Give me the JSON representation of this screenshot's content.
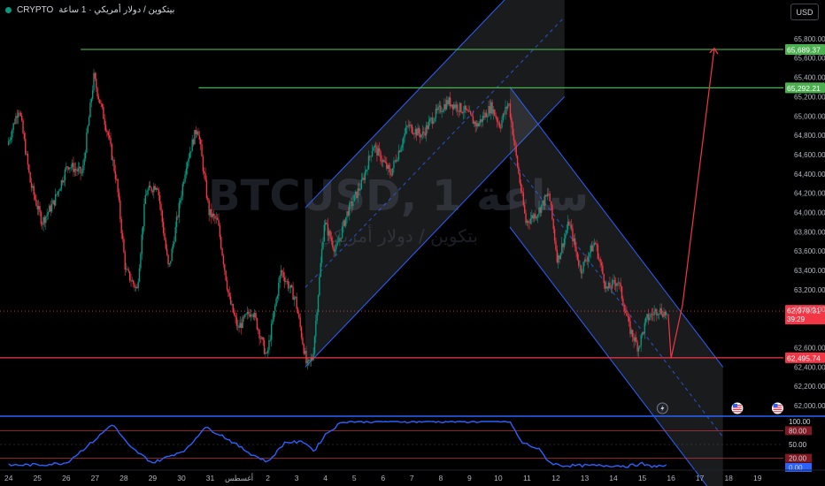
{
  "header": {
    "symbol": "CRYPTO",
    "exchange_text": "بيتكوين / دولار أمريكي · 1 ساعة",
    "currency_button": "USD"
  },
  "watermark": {
    "main": "BTCUSD, 1 ساعة",
    "sub": "بتكوين / دولار أمريكي"
  },
  "colors": {
    "background": "#000000",
    "up": "#089981",
    "down": "#f23645",
    "channel": "#2962ff",
    "green_line": "#4caf50",
    "red_line": "#f23645",
    "rsi": "#2962ff"
  },
  "chart_data": {
    "type": "candlestick",
    "price_axis": {
      "min": 61900,
      "max": 66000,
      "ticks": [
        "65,800.00",
        "65,600.00",
        "65,400.00",
        "65,200.00",
        "65,000.00",
        "64,800.00",
        "64,600.00",
        "64,400.00",
        "64,200.00",
        "64,000.00",
        "63,800.00",
        "63,600.00",
        "63,400.00",
        "63,200.00",
        "63,000.00",
        "62,600.00",
        "62,400.00",
        "62,200.00",
        "62,000.00"
      ],
      "tick_values": [
        65800,
        65600,
        65400,
        65200,
        65000,
        64800,
        64600,
        64400,
        64200,
        64000,
        63800,
        63600,
        63400,
        63200,
        63000,
        62600,
        62400,
        62200,
        62000
      ]
    },
    "time_axis": {
      "labels": [
        "24",
        "25",
        "26",
        "27",
        "28",
        "29",
        "30",
        "31",
        "أغسطس",
        "2",
        "3",
        "4",
        "5",
        "6",
        "7",
        "8",
        "9",
        "10",
        "11",
        "12",
        "13",
        "14",
        "15",
        "16",
        "17",
        "18",
        "19"
      ],
      "day_offsets": [
        0,
        1,
        2,
        3,
        4,
        5,
        6,
        7,
        8,
        9,
        10,
        11,
        12,
        13,
        14,
        15,
        16,
        17,
        18,
        19,
        20,
        21,
        22,
        23,
        24,
        25,
        26
      ],
      "range": [
        -0.3,
        26.9
      ]
    },
    "anchors": [
      {
        "d": 0,
        "p": 64700
      },
      {
        "d": 0.4,
        "p": 65100
      },
      {
        "d": 0.8,
        "p": 64300
      },
      {
        "d": 1.2,
        "p": 63900
      },
      {
        "d": 1.6,
        "p": 64100
      },
      {
        "d": 2.1,
        "p": 64500
      },
      {
        "d": 2.6,
        "p": 64400
      },
      {
        "d": 3.0,
        "p": 65400
      },
      {
        "d": 3.5,
        "p": 64800
      },
      {
        "d": 3.8,
        "p": 64300
      },
      {
        "d": 4.1,
        "p": 63400
      },
      {
        "d": 4.5,
        "p": 63200
      },
      {
        "d": 4.8,
        "p": 64200
      },
      {
        "d": 5.2,
        "p": 64300
      },
      {
        "d": 5.6,
        "p": 63400
      },
      {
        "d": 6.2,
        "p": 64500
      },
      {
        "d": 6.6,
        "p": 64900
      },
      {
        "d": 7.0,
        "p": 64000
      },
      {
        "d": 7.3,
        "p": 63900
      },
      {
        "d": 7.7,
        "p": 63100
      },
      {
        "d": 8.0,
        "p": 62800
      },
      {
        "d": 8.5,
        "p": 63000
      },
      {
        "d": 9.0,
        "p": 62500
      },
      {
        "d": 9.5,
        "p": 63400
      },
      {
        "d": 10.0,
        "p": 63100
      },
      {
        "d": 10.4,
        "p": 62400
      },
      {
        "d": 10.6,
        "p": 62500
      },
      {
        "d": 11.0,
        "p": 63900
      },
      {
        "d": 11.4,
        "p": 63600
      },
      {
        "d": 11.8,
        "p": 64000
      },
      {
        "d": 12.3,
        "p": 64300
      },
      {
        "d": 12.7,
        "p": 64700
      },
      {
        "d": 13.3,
        "p": 64400
      },
      {
        "d": 13.9,
        "p": 64900
      },
      {
        "d": 14.4,
        "p": 64800
      },
      {
        "d": 14.8,
        "p": 65000
      },
      {
        "d": 15.3,
        "p": 65150
      },
      {
        "d": 15.9,
        "p": 65050
      },
      {
        "d": 16.3,
        "p": 64900
      },
      {
        "d": 16.8,
        "p": 65100
      },
      {
        "d": 17.1,
        "p": 64900
      },
      {
        "d": 17.4,
        "p": 65150
      },
      {
        "d": 17.7,
        "p": 64500
      },
      {
        "d": 18.0,
        "p": 63900
      },
      {
        "d": 18.4,
        "p": 64000
      },
      {
        "d": 18.8,
        "p": 64200
      },
      {
        "d": 19.1,
        "p": 63500
      },
      {
        "d": 19.5,
        "p": 63900
      },
      {
        "d": 19.9,
        "p": 63400
      },
      {
        "d": 20.4,
        "p": 63700
      },
      {
        "d": 20.8,
        "p": 63200
      },
      {
        "d": 21.2,
        "p": 63300
      },
      {
        "d": 21.6,
        "p": 62800
      },
      {
        "d": 21.9,
        "p": 62600
      },
      {
        "d": 22.2,
        "p": 62900
      },
      {
        "d": 22.6,
        "p": 63000
      },
      {
        "d": 22.85,
        "p": 62950
      }
    ],
    "levels": [
      {
        "name": "upper-level",
        "value": 65689.37,
        "label": "65,689.37",
        "color": "#4caf50",
        "from_day": 2.5
      },
      {
        "name": "middle-level",
        "value": 65292.21,
        "label": "65,292.21",
        "color": "#4caf50",
        "from_day": 6.6
      },
      {
        "name": "support-level",
        "value": 62495.74,
        "label": "62,495.74",
        "color": "#f23645",
        "from_day": -0.3
      }
    ],
    "current_price": {
      "value": 62979.31,
      "label": "62,979.31",
      "countdown": "39:29"
    },
    "ascending_channel": {
      "d1": 10.3,
      "d2": 19.3,
      "lower1": 62400,
      "lower2": 65200,
      "upper1": 64050,
      "upper2": 66850
    },
    "descending_channel": {
      "d1": 17.4,
      "d2": 24.8,
      "upper1": 65300,
      "upper2": 62400,
      "lower1": 63850,
      "lower2": 60950
    },
    "projection": [
      {
        "d": 22.9,
        "p": 62950
      },
      {
        "d": 23.0,
        "p": 62490
      },
      {
        "d": 23.4,
        "p": 63050
      },
      {
        "d": 24.5,
        "p": 65700
      }
    ],
    "event_markers": [
      {
        "name": "lightning-event-icon",
        "day": 22.7
      },
      {
        "name": "us-flag-event-icon",
        "day": 25.3
      },
      {
        "name": "us-flag-event-icon",
        "day": 26.7
      }
    ],
    "rsi": {
      "ticks": [
        "100.00",
        "80.00",
        "50.00",
        "20.00",
        "0.00"
      ],
      "tick_values": [
        100,
        80,
        50,
        20,
        0
      ],
      "current": "0.00",
      "anchors": [
        {
          "d": 0,
          "v": 5
        },
        {
          "d": 1.2,
          "v": 6
        },
        {
          "d": 2,
          "v": 10
        },
        {
          "d": 3,
          "v": 60
        },
        {
          "d": 3.6,
          "v": 95
        },
        {
          "d": 4.2,
          "v": 45
        },
        {
          "d": 5,
          "v": 10
        },
        {
          "d": 6.2,
          "v": 40
        },
        {
          "d": 6.8,
          "v": 88
        },
        {
          "d": 7.4,
          "v": 70
        },
        {
          "d": 8.4,
          "v": 30
        },
        {
          "d": 9.0,
          "v": 12
        },
        {
          "d": 9.6,
          "v": 55
        },
        {
          "d": 10.3,
          "v": 55
        },
        {
          "d": 10.6,
          "v": 35
        },
        {
          "d": 11.0,
          "v": 72
        },
        {
          "d": 11.6,
          "v": 100
        },
        {
          "d": 17.4,
          "v": 100
        },
        {
          "d": 17.8,
          "v": 55
        },
        {
          "d": 18.4,
          "v": 40
        },
        {
          "d": 18.8,
          "v": 10
        },
        {
          "d": 19.2,
          "v": 4
        },
        {
          "d": 21,
          "v": 4
        },
        {
          "d": 21.5,
          "v": 3
        },
        {
          "d": 22,
          "v": 8
        },
        {
          "d": 22.2,
          "v": 3
        },
        {
          "d": 22.85,
          "v": 3
        }
      ]
    }
  }
}
